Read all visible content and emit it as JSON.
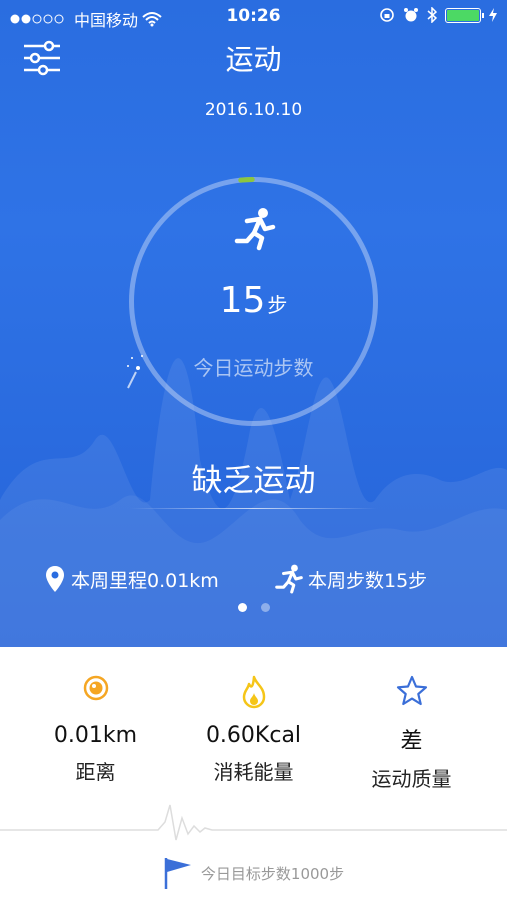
{
  "status_bar": {
    "carrier": "中国移动",
    "time": "10:26",
    "battery_level": 1.0,
    "signal_bars_filled": 2,
    "signal_bars_total": 5
  },
  "header": {
    "title": "运动",
    "menu_icon": "sliders-icon"
  },
  "date": "2016.10.10",
  "progress": {
    "steps_value": "15",
    "steps_unit": "步",
    "steps_label": "今日运动步数",
    "fraction": 0.015
  },
  "activity_status": "缺乏运动",
  "weekly": {
    "distance": "本周里程0.01km",
    "steps": "本周步数15步"
  },
  "pager": {
    "count": 2,
    "active": 0
  },
  "stats": [
    {
      "value": "0.01km",
      "label": "距离",
      "icon": "distance-icon"
    },
    {
      "value": "0.60Kcal",
      "label": "消耗能量",
      "icon": "flame-icon"
    },
    {
      "value": "差",
      "label": "运动质量",
      "icon": "star-icon"
    }
  ],
  "goal": "今日目标步数1000步",
  "colors": {
    "accent": "#2a6de0",
    "progress_marker": "#8cc63f",
    "distance_icon": "#f5a623",
    "flame_icon": "#f5c518",
    "star_icon": "#3b6fd8"
  }
}
